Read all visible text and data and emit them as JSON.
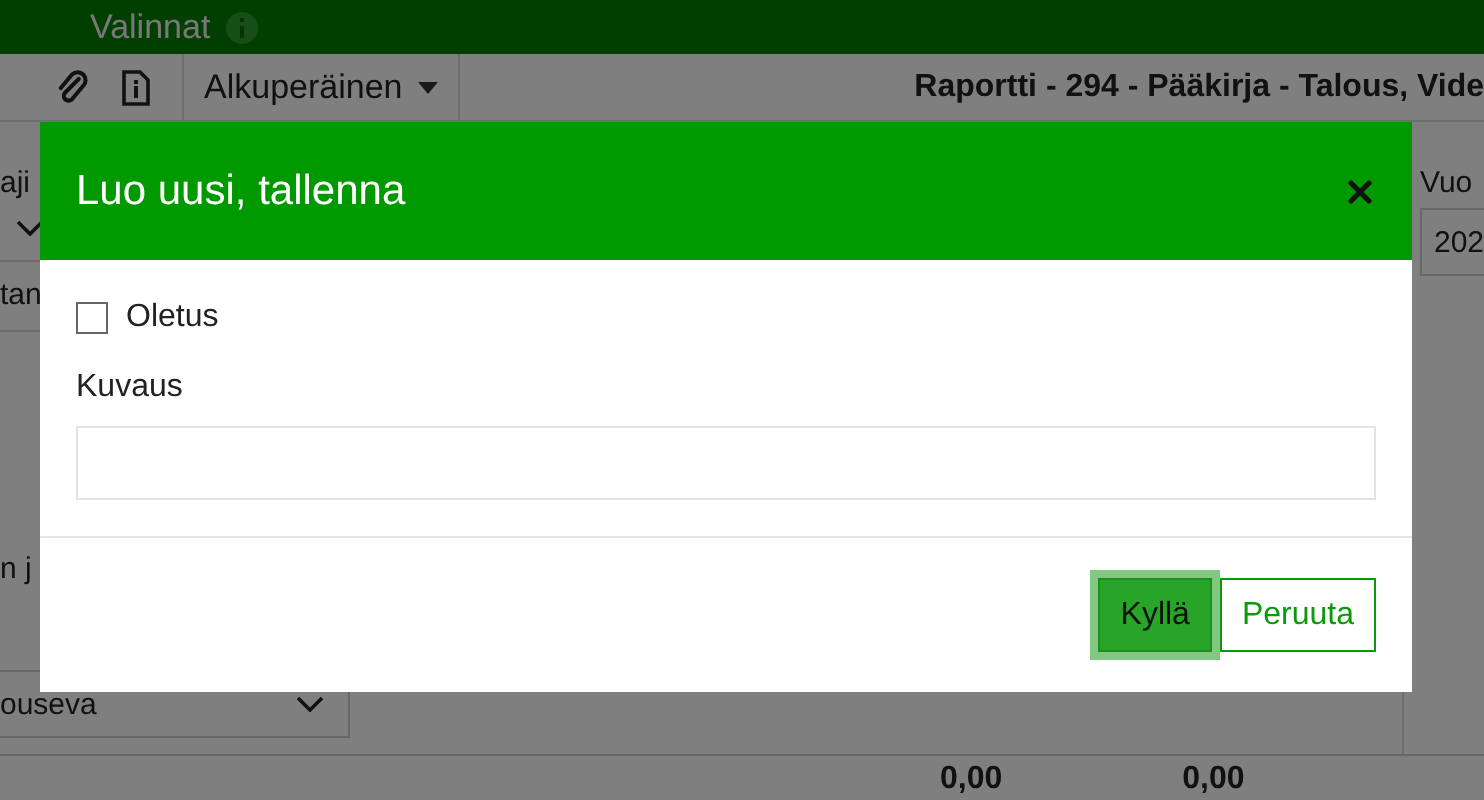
{
  "topbar": {
    "title": "Valinnat"
  },
  "toolbar": {
    "view_menu": "Alkuperäinen",
    "report_title": "Raportti - 294 - Pääkirja - Talous, Vide"
  },
  "background": {
    "type_label": "aji",
    "tab_label": "tan",
    "option_label": "n j",
    "sort_select": "ouseva",
    "year_label": "Vuo",
    "year_field": "202",
    "totals": [
      "0,00",
      "0,00"
    ]
  },
  "dialog": {
    "title": "Luo uusi, tallenna",
    "default_checkbox": {
      "label": "Oletus",
      "checked": false
    },
    "description": {
      "label": "Kuvaus"
    },
    "buttons": [
      {
        "label": "Kyllä",
        "kind": "primary",
        "focused": true
      },
      {
        "label": "Peruuta",
        "kind": "secondary",
        "focused": false
      }
    ]
  }
}
